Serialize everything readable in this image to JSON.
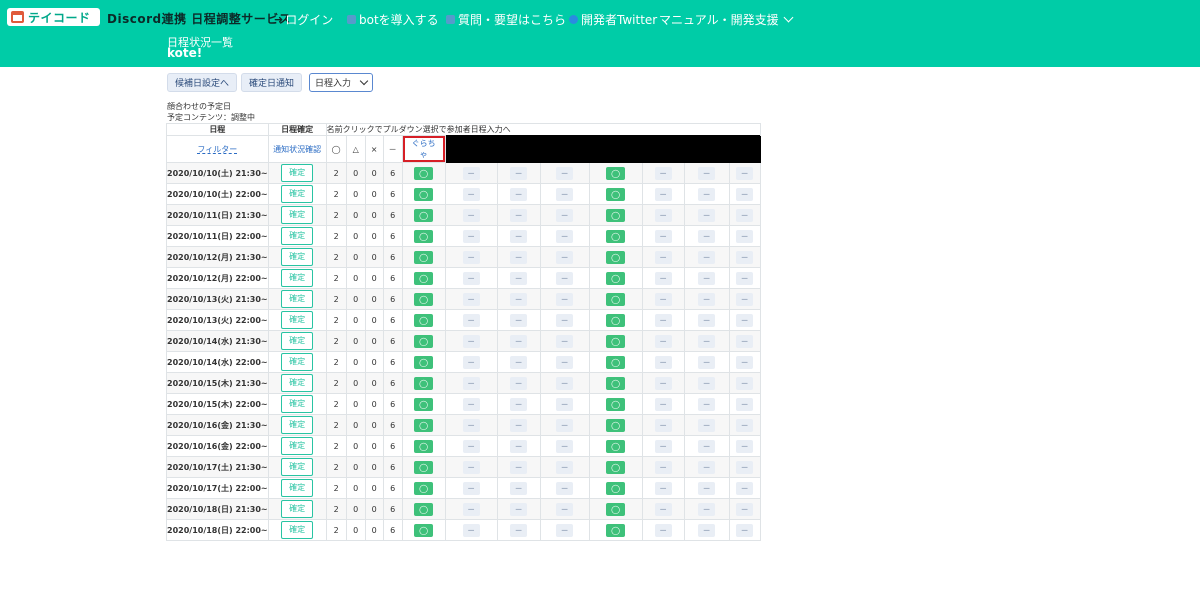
{
  "header": {
    "logo_text": "テイコード",
    "tagline": "Discord連携 日程調整サービス",
    "nav": {
      "login": "ログイン",
      "add_bot": "botを導入する",
      "questions": "質問・要望はこちら",
      "twitter": "開発者Twitter",
      "manual": "マニュアル・開発支援"
    },
    "subtitle": "日程状況一覧",
    "event_name": "kote!"
  },
  "toolbar": {
    "candidate_btn": "候補日設定へ",
    "notify_btn": "確定日通知",
    "select_value": "日程入力"
  },
  "info": {
    "line1": "顔合わせの予定日",
    "line2": "予定コンテンツ：調整中"
  },
  "table": {
    "h_date": "日程",
    "h_filter": "フィルター",
    "h_confirm": "日程確定",
    "h_notify": "通知状況確認",
    "h_names_note": "名前クリックでプルダウン選択で参加者日程入力へ",
    "h_sym_o": "◯",
    "h_sym_tri": "△",
    "h_sym_x": "×",
    "h_sym_dash": "－",
    "h_member1": "ぐらちゃ",
    "confirm_label": "確定",
    "ok_symbol": "◯",
    "na_symbol": "－",
    "rows": [
      {
        "date": "2020/10/10(土) 21:30~",
        "o": "2",
        "t": "0",
        "x": "0",
        "d": "6"
      },
      {
        "date": "2020/10/10(土) 22:00~",
        "o": "2",
        "t": "0",
        "x": "0",
        "d": "6"
      },
      {
        "date": "2020/10/11(日) 21:30~",
        "o": "2",
        "t": "0",
        "x": "0",
        "d": "6"
      },
      {
        "date": "2020/10/11(日) 22:00~",
        "o": "2",
        "t": "0",
        "x": "0",
        "d": "6"
      },
      {
        "date": "2020/10/12(月) 21:30~",
        "o": "2",
        "t": "0",
        "x": "0",
        "d": "6"
      },
      {
        "date": "2020/10/12(月) 22:00~",
        "o": "2",
        "t": "0",
        "x": "0",
        "d": "6"
      },
      {
        "date": "2020/10/13(火) 21:30~",
        "o": "2",
        "t": "0",
        "x": "0",
        "d": "6"
      },
      {
        "date": "2020/10/13(火) 22:00~",
        "o": "2",
        "t": "0",
        "x": "0",
        "d": "6"
      },
      {
        "date": "2020/10/14(水) 21:30~",
        "o": "2",
        "t": "0",
        "x": "0",
        "d": "6"
      },
      {
        "date": "2020/10/14(水) 22:00~",
        "o": "2",
        "t": "0",
        "x": "0",
        "d": "6"
      },
      {
        "date": "2020/10/15(木) 21:30~",
        "o": "2",
        "t": "0",
        "x": "0",
        "d": "6"
      },
      {
        "date": "2020/10/15(木) 22:00~",
        "o": "2",
        "t": "0",
        "x": "0",
        "d": "6"
      },
      {
        "date": "2020/10/16(金) 21:30~",
        "o": "2",
        "t": "0",
        "x": "0",
        "d": "6"
      },
      {
        "date": "2020/10/16(金) 22:00~",
        "o": "2",
        "t": "0",
        "x": "0",
        "d": "6"
      },
      {
        "date": "2020/10/17(土) 21:30~",
        "o": "2",
        "t": "0",
        "x": "0",
        "d": "6"
      },
      {
        "date": "2020/10/17(土) 22:00~",
        "o": "2",
        "t": "0",
        "x": "0",
        "d": "6"
      },
      {
        "date": "2020/10/18(日) 21:30~",
        "o": "2",
        "t": "0",
        "x": "0",
        "d": "6"
      },
      {
        "date": "2020/10/18(日) 22:00~",
        "o": "2",
        "t": "0",
        "x": "0",
        "d": "6"
      }
    ],
    "member_marks": [
      "ok",
      "na",
      "na",
      "na",
      "ok",
      "na",
      "na",
      "na"
    ]
  },
  "colors": {
    "header_bg": "#00cca7",
    "ok_green": "#3ec17a",
    "confirm_teal": "#29c4a3",
    "highlight_red": "#d61f26"
  }
}
